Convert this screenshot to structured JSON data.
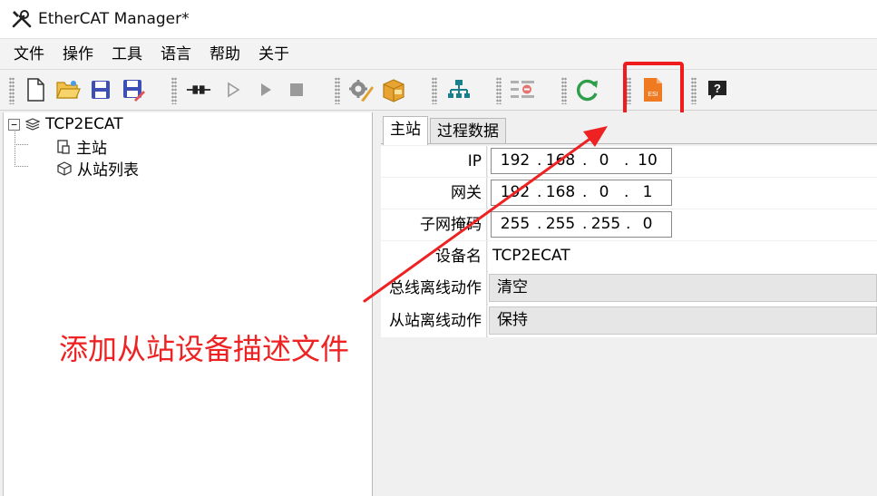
{
  "window": {
    "title": "EtherCAT Manager*"
  },
  "menu": [
    {
      "label": "文件"
    },
    {
      "label": "操作"
    },
    {
      "label": "工具"
    },
    {
      "label": "语言"
    },
    {
      "label": "帮助"
    },
    {
      "label": "关于"
    }
  ],
  "toolbar": {
    "buttons": [
      {
        "icon": "new-file-icon"
      },
      {
        "icon": "open-folder-icon"
      },
      {
        "icon": "save-icon"
      },
      {
        "icon": "save-as-icon"
      },
      {
        "icon": "connect-icon"
      },
      {
        "icon": "run-outline-icon"
      },
      {
        "icon": "run-icon"
      },
      {
        "icon": "stop-icon"
      },
      {
        "icon": "settings-edit-icon"
      },
      {
        "icon": "package-icon"
      },
      {
        "icon": "network-topology-icon"
      },
      {
        "icon": "remove-icon"
      },
      {
        "icon": "refresh-icon"
      },
      {
        "icon": "esi-file-icon",
        "label": "ESI"
      },
      {
        "icon": "help-icon"
      }
    ]
  },
  "tree": {
    "root": {
      "label": "TCP2ECAT",
      "expander": "−"
    },
    "children": [
      {
        "label": "主站"
      },
      {
        "label": "从站列表"
      }
    ]
  },
  "tabs": [
    {
      "label": "主站",
      "active": true
    },
    {
      "label": "过程数据",
      "active": false
    }
  ],
  "properties": {
    "ip": {
      "label": "IP",
      "parts": [
        "192",
        "168",
        "0",
        "10"
      ]
    },
    "gateway": {
      "label": "网关",
      "parts": [
        "192",
        "168",
        "0",
        "1"
      ]
    },
    "subnet": {
      "label": "子网掩码",
      "parts": [
        "255",
        "255",
        "255",
        "0"
      ]
    },
    "device_name": {
      "label": "设备名",
      "value": "TCP2ECAT"
    },
    "bus_offline_action": {
      "label": "总线离线动作",
      "value": "清空"
    },
    "slave_offline_action": {
      "label": "从站离线动作",
      "value": "保持"
    }
  },
  "annotation": {
    "text": "添加从站设备描述文件",
    "color": "#ee2222"
  },
  "colors": {
    "accent_red": "#ee1c1c",
    "save_blue": "#3d4fb5",
    "refresh_green": "#2e9e4a",
    "esi_orange": "#f07a22"
  }
}
